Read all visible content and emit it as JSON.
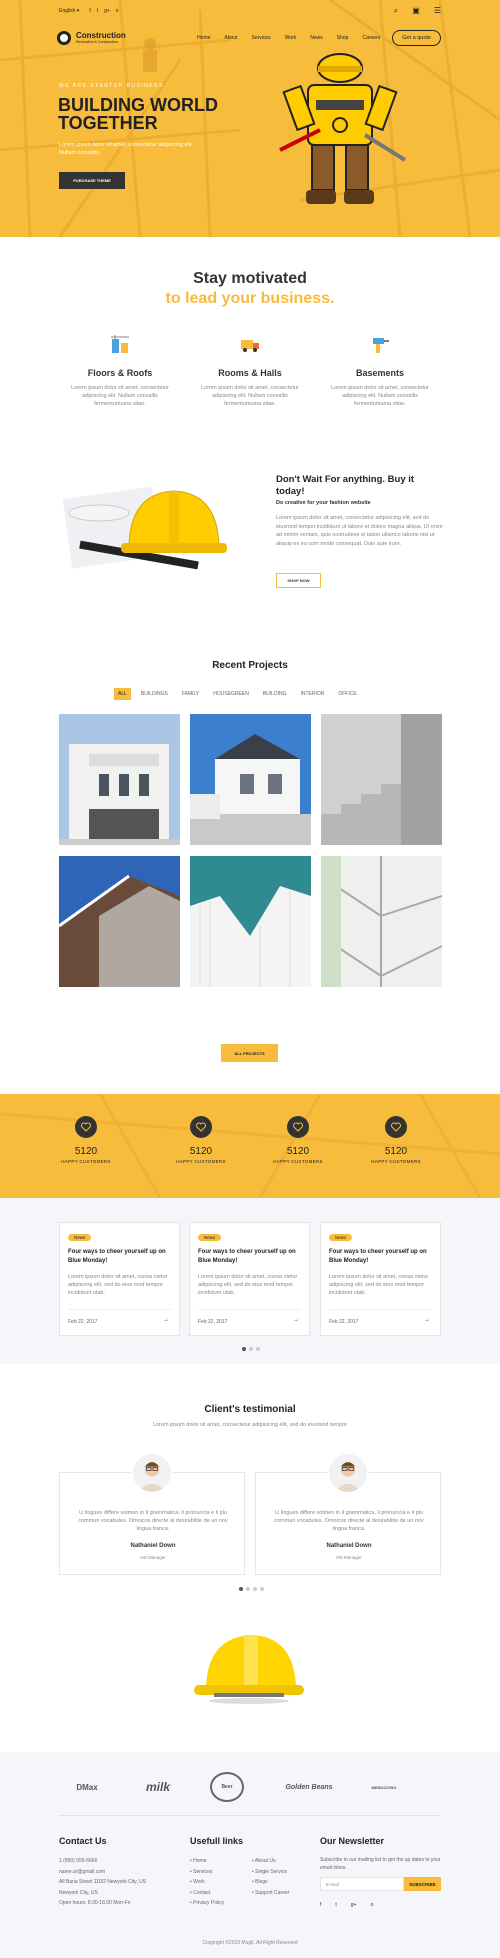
{
  "colors": {
    "accent": "#f7bc3b",
    "dark": "#333333"
  },
  "topbar": {
    "language": "English ▾",
    "social_icons": [
      "f",
      "t",
      "g+",
      "o"
    ],
    "search_icon": "⌕",
    "cart_icon": "▣",
    "menu_icon": "☰"
  },
  "nav": {
    "brand": "Construction",
    "brand_sub": "Renovation & Construction",
    "items": [
      "Home",
      "About",
      "Services",
      "Work",
      "News",
      "Shop",
      "Careers"
    ],
    "cta": "Get a quote"
  },
  "hero": {
    "kicker": "WE ARE STARTUP BUSINESS",
    "title": "BUILDING WORLD TOGETHER",
    "subtitle": "Lorem ipsum dolor sit amet, consectetur adipiscing elit. Nullam convallis.",
    "button": "PURCHASE THEME"
  },
  "motivated": {
    "line1": "Stay motivated",
    "line2": "to lead your business."
  },
  "features": [
    {
      "title": "Floors & Roofs",
      "text": "Lorem ipsum dolor sit amet, consectetur adipiscing elit. Nullam convallis fermentumuma vitae.",
      "icon": "building-icon"
    },
    {
      "title": "Rooms & Halls",
      "text": "Lorem ipsum dolor sit amet, consectetur adipiscing elit. Nullam convallis fermentumuma vitae.",
      "icon": "truck-icon"
    },
    {
      "title": "Basements",
      "text": "Lorem ipsum dolor sit amet, consectetur adipiscing elit. Nullam convallis fermentumuma vitae.",
      "icon": "drill-icon"
    }
  ],
  "promo": {
    "title": "Don't Wait For anything. Buy it today!",
    "subtitle": "Do creative for your fashion website",
    "text": "Lorem ipsum dolor sit amet, consectetur adipisicing elit, sed do eiusmod tempor incididunt ut labore et dolore magna aliqua. Ut enim ad minim veniam, quis nostrudexe ei tation ullamco laboris nisi ut aliquip ex ea com modo consequat. Duis aute irure.",
    "button": "SHOP NOW"
  },
  "projects": {
    "title": "Recent Projects",
    "filters": [
      "ALL",
      "BUILDINGS",
      "FAMILY",
      "HOUSEGREEN",
      "BUILDING",
      "INTERIOR",
      "OFFICE"
    ],
    "button": "ALL PROJECTS"
  },
  "counters": [
    {
      "value": "5120",
      "label": "HAPPY CUSTOMERS"
    },
    {
      "value": "5120",
      "label": "HAPPY CUSTOMERS"
    },
    {
      "value": "5120",
      "label": "HAPPY CUSTOMERS"
    },
    {
      "value": "5120",
      "label": "HAPPY CUSTOMERS"
    }
  ],
  "news": [
    {
      "tag": "News",
      "title": "Four ways to cheer yourself up on Blue Monday!",
      "text": "Lorem ipsum dolor sit amet, consa ctetur adipiscing elit, sed do eius mod tempor incididunt utab.",
      "date": "Feb 22, 2017",
      "arrow": "→"
    },
    {
      "tag": "News",
      "title": "Four ways to cheer yourself up on Blue Monday!",
      "text": "Lorem ipsum dolor sit amet, consa ctetur adipiscing elit, sed do eius mod tempor incididunt utab.",
      "date": "Feb 22, 2017",
      "arrow": "→"
    },
    {
      "tag": "News",
      "title": "Four ways to cheer yourself up on Blue Monday!",
      "text": "Lorem ipsum dolor sit amet, consa ctetur adipiscing elit, sed do eius mod tempor incididunt utab.",
      "date": "Feb 22, 2017",
      "arrow": "→"
    }
  ],
  "testimonial": {
    "title": "Client's testimonial",
    "subtitle": "Lorem ipsum dolor sit amet, consectetur adipisicing elit, sed do eiusmod tempor",
    "items": [
      {
        "quote": "Li lingues differe solmen in li grammatica, li pronuncia e li plu commun vocabules. Omnicos directe al desirabilite de un nov lingua franca.",
        "name": "Nathaniel Down",
        "role": "HD Manager"
      },
      {
        "quote": "Li lingues differe solmen in li grammatica, li pronuncia e li plu commun vocabules. Omnicos directe al desirabilite de un nov lingua franca.",
        "name": "Nathaniel Down",
        "role": "HD Manager"
      }
    ]
  },
  "brands": [
    "DMax",
    "milk",
    "Beer",
    "Golden Beans",
    "MENDOCINO"
  ],
  "footer": {
    "contact_title": "Contact Us",
    "contact_lines": [
      "1 (800) 555-6666",
      "name.ar@gmail.com",
      "All Baria Street 110/2 Newyork City, US",
      "Newyork City, US",
      "Open hours: 8.00-18.00 Mon-Fri"
    ],
    "links_title": "Usefull links",
    "links_col1": [
      "Home",
      "Services",
      "Work",
      "Contact",
      "Privacy Policy"
    ],
    "links_col2": [
      "About Us",
      "Single Service",
      "Blogs",
      "Support Career"
    ],
    "newsletter_title": "Our Newsletter",
    "newsletter_text": "Subscribe to our mailing list to get the up dates to your email inbox.",
    "email_placeholder": "E-mail",
    "subscribe": "SUBSCRIBE",
    "social": [
      "f",
      "t",
      "g+",
      "o"
    ]
  },
  "copyright": "Copyright ©2018 MuglI. All Right Reserved"
}
